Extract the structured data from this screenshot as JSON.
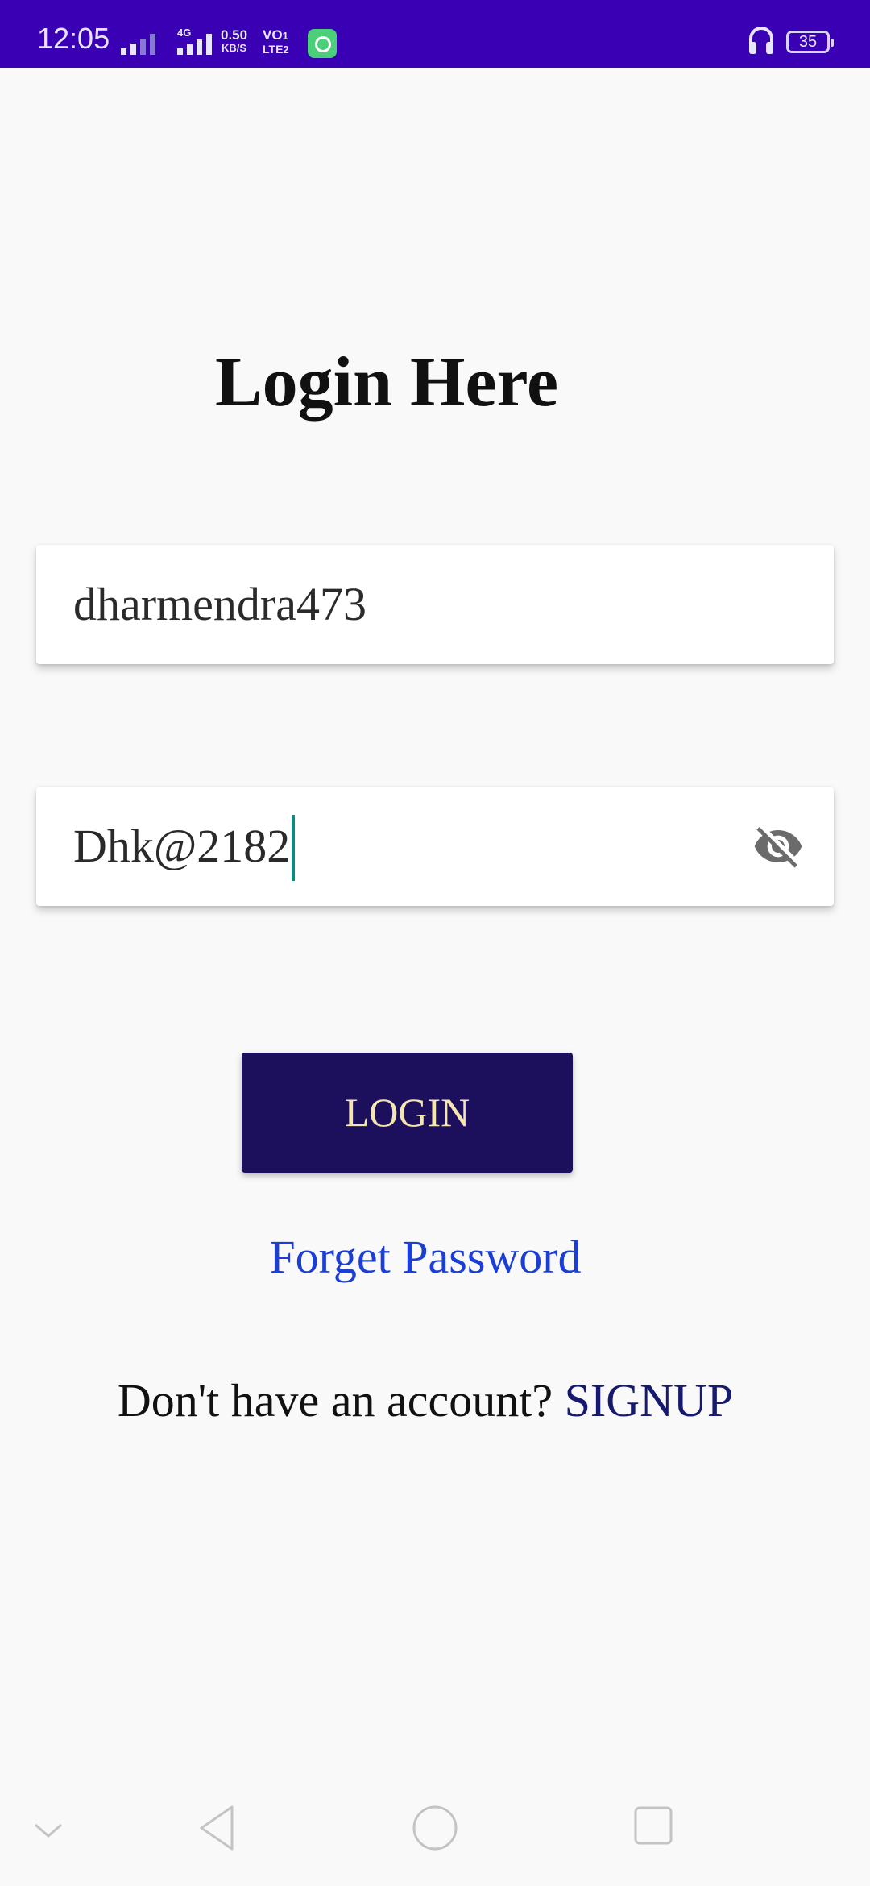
{
  "status_bar": {
    "time": "12:05",
    "network_type": "4G",
    "net_speed_value": "0.50",
    "net_speed_unit": "KB/S",
    "volte_top": "VO",
    "volte_bottom": "LTE",
    "sim_badge_1": "1",
    "sim_badge_2": "2",
    "battery_level": "35",
    "icons": [
      "signal-icon",
      "signal-icon",
      "app-notification-icon",
      "headset-icon",
      "battery-icon"
    ]
  },
  "login": {
    "title": "Login Here",
    "username_value": "dharmendra473",
    "password_value": "Dhk@2182",
    "password_toggle_icon": "visibility-off-icon",
    "login_button_label": "LOGIN",
    "forgot_password_label": "Forget Password",
    "signup_prompt": "Don't have an account? ",
    "signup_link_label": "SIGNUP"
  },
  "colors": {
    "status_bar": "#3a00b4",
    "background": "#f9f9f9",
    "button_bg": "#1c0f5c",
    "button_text": "#f5e6b0",
    "link": "#1a3ed6",
    "signup_link": "#151a6e",
    "caret": "#0e8a80"
  },
  "nav_bar": {
    "icons": [
      "collapse-chevron-icon",
      "back-icon",
      "home-icon",
      "recents-icon"
    ]
  }
}
